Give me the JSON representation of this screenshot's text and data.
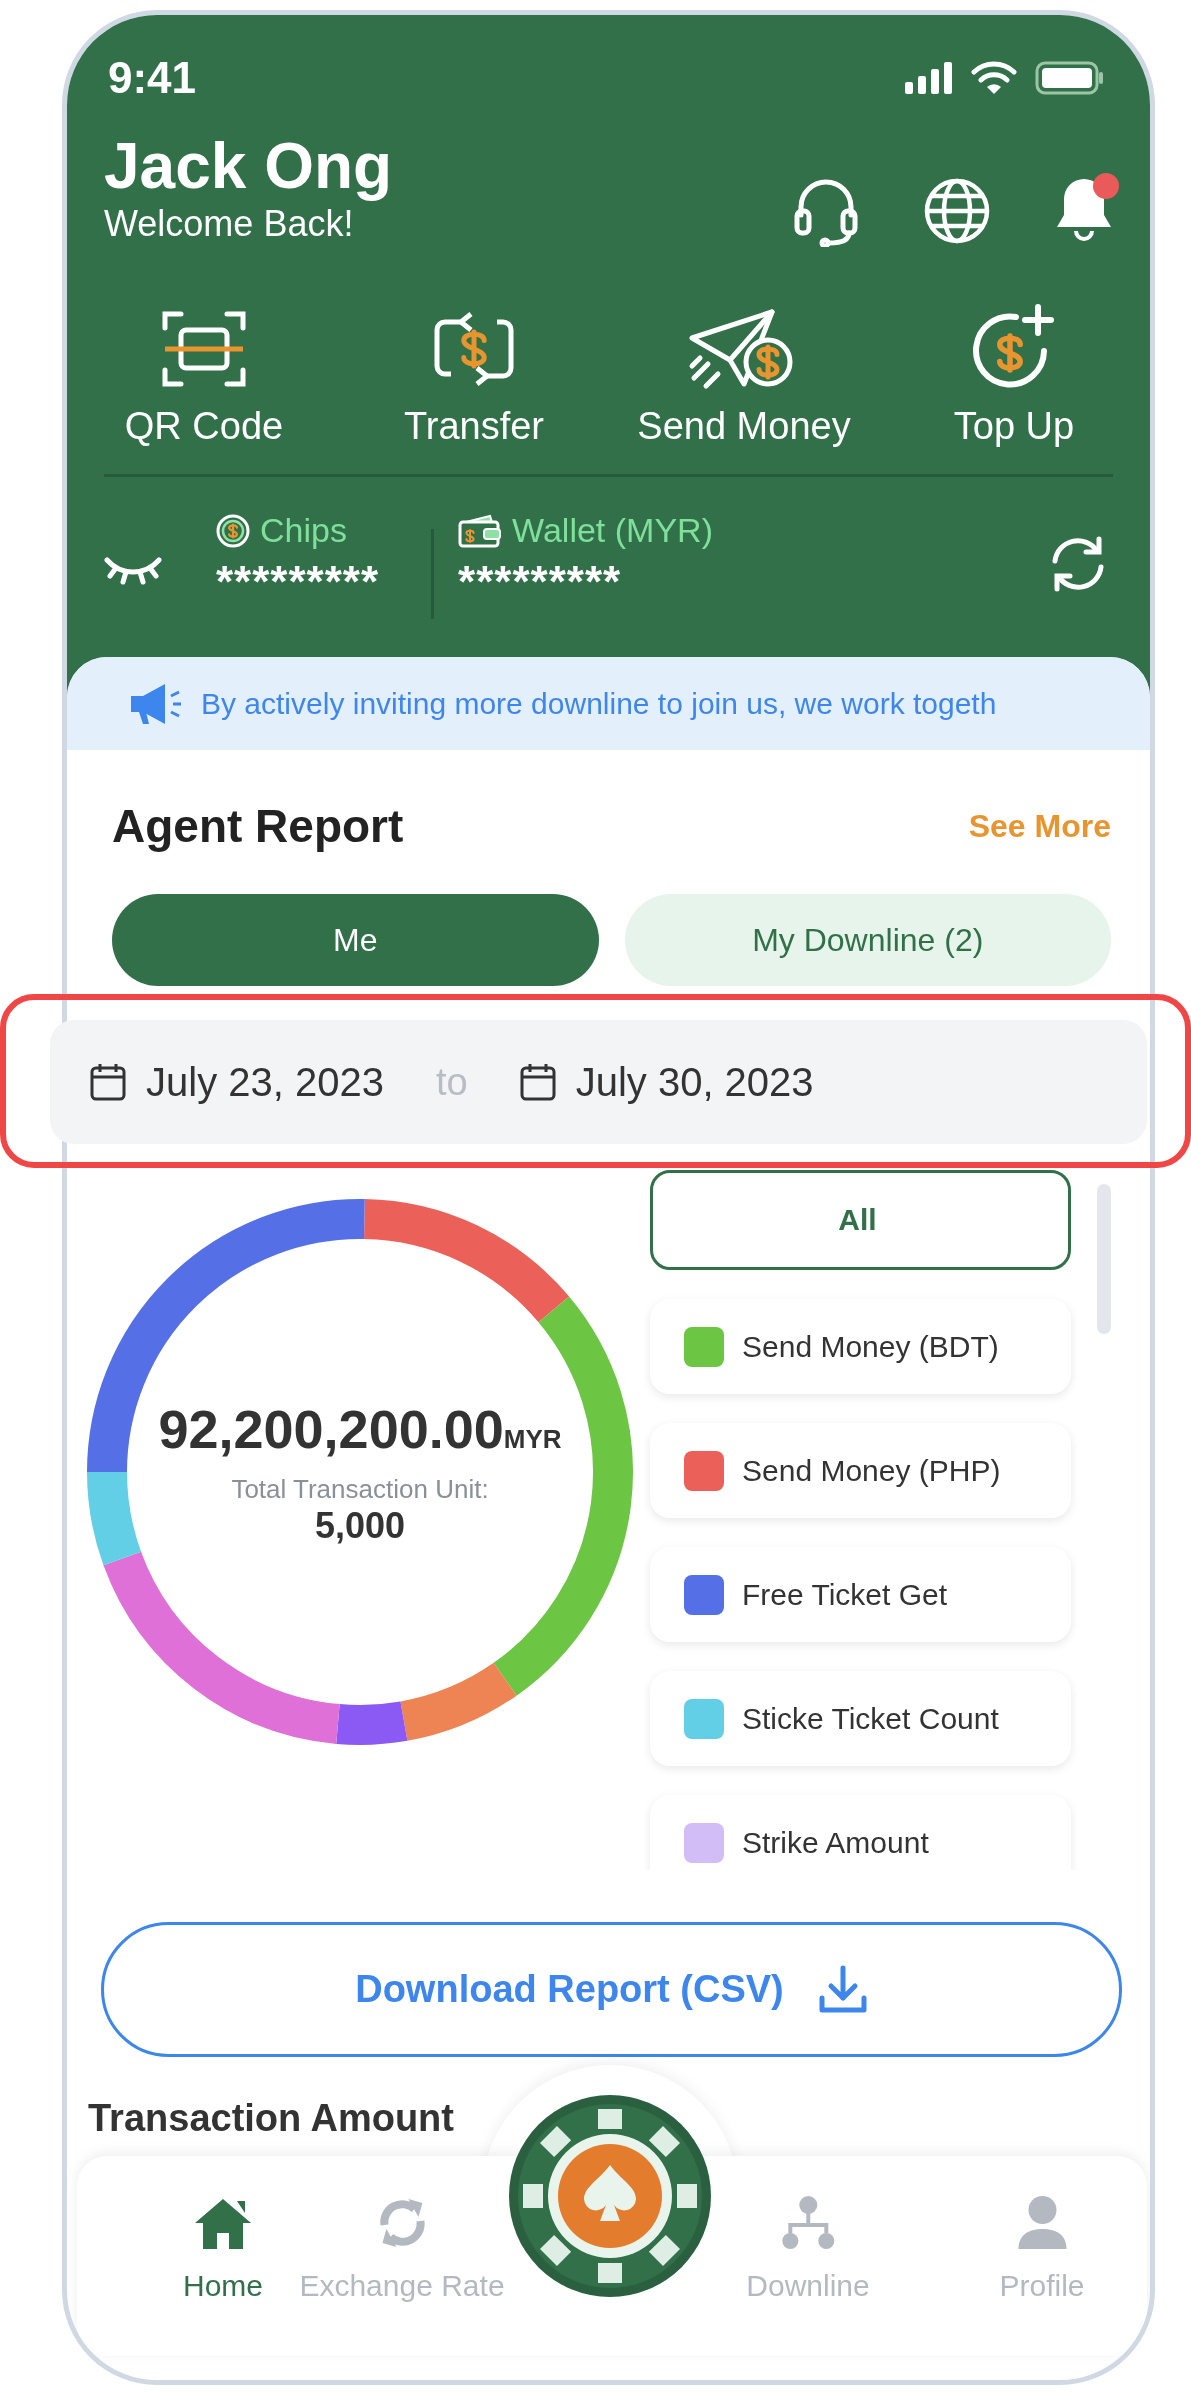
{
  "status_bar": {
    "time": "9:41"
  },
  "user": {
    "name": "Jack Ong",
    "greeting": "Welcome Back!",
    "has_notification": true
  },
  "quick_actions": [
    {
      "kind": "qr",
      "label": "QR Code"
    },
    {
      "kind": "transfer",
      "label": "Transfer"
    },
    {
      "kind": "send",
      "label": "Send Money"
    },
    {
      "kind": "topup",
      "label": "Top Up"
    }
  ],
  "balances": [
    {
      "kind": "chips",
      "label": "Chips",
      "value": "*********"
    },
    {
      "kind": "wallet",
      "label": "Wallet (MYR)",
      "value": "*********"
    }
  ],
  "announcement": "By actively inviting more downline to join us, we work togeth",
  "agent_report": {
    "title": "Agent Report",
    "see_more": "See More",
    "tabs": [
      {
        "label": "Me",
        "selected": true
      },
      {
        "label": "My Downline (2)",
        "selected": false
      }
    ],
    "date_from": "July 23, 2023",
    "date_separator": "to",
    "date_to": "July 30, 2023",
    "total_amount": "92,200,200.00",
    "currency": "MYR",
    "unit_label": "Total Transaction Unit:",
    "unit_value": "5,000",
    "filters": [
      {
        "label": "All",
        "selected": true
      },
      {
        "label": "Send Money (BDT)",
        "color": "#6cc644",
        "selected": false
      },
      {
        "label": "Send Money (PHP)",
        "color": "#eb6159",
        "selected": false
      },
      {
        "label": "Free Ticket Get",
        "color": "#5570e6",
        "selected": false
      },
      {
        "label": "Sticke Ticket Count",
        "color": "#62cfe6",
        "selected": false
      },
      {
        "label": "Strike Amount",
        "color": "#d2bdf7",
        "selected": false
      }
    ],
    "download_button": "Download Report (CSV)"
  },
  "section_title": "Transaction Amount",
  "nav": [
    {
      "kind": "home",
      "label": "Home",
      "selected": true
    },
    {
      "kind": "exchange",
      "label": "Exchange Rate",
      "selected": false
    },
    {
      "kind": "downline",
      "label": "Downline",
      "selected": false
    },
    {
      "kind": "profile",
      "label": "Profile",
      "selected": false
    }
  ]
}
